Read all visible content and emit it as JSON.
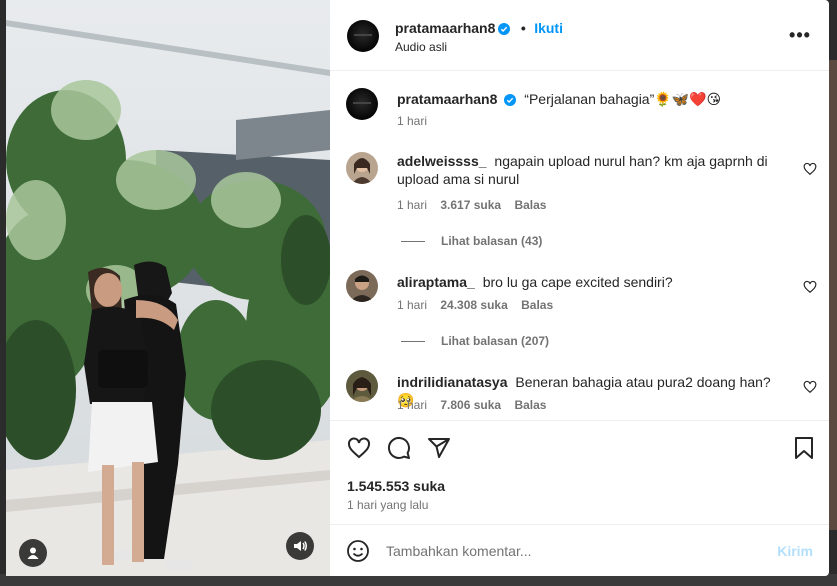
{
  "post": {
    "username": "pratamaarhan8",
    "follow_label": "Ikuti",
    "audio_label": "Audio asli",
    "more_label": "•••",
    "caption": "“Perjalanan bahagia”🌻🦋❤️😘",
    "caption_time": "1 hari",
    "likes_total": "1.545.553 suka",
    "time_ago": "1 hari yang lalu"
  },
  "comments": [
    {
      "username": "adelweissss_",
      "text": "ngapain upload nurul han? km aja gaprnh di upload ama si nurul",
      "time": "1 hari",
      "likes": "3.617 suka",
      "reply_label": "Balas",
      "view_replies": "Lihat balasan (43)"
    },
    {
      "username": "aliraptama_",
      "text": "bro lu ga cape excited sendiri?",
      "time": "1 hari",
      "likes": "24.308 suka",
      "reply_label": "Balas",
      "view_replies": "Lihat balasan (207)"
    },
    {
      "username": "indrilidianatasya",
      "text": "Beneran bahagia atau pura2 doang han?🥺",
      "time": "1 hari",
      "likes": "7.806 suka",
      "reply_label": "Balas"
    }
  ],
  "add_comment": {
    "placeholder": "Tambahkan komentar...",
    "post_label": "Kirim"
  },
  "colors": {
    "accent": "#0095f6",
    "verified": "#0095f6",
    "post_disabled": "#b2dffc",
    "heart_filled": "#ff3040"
  },
  "icons": {
    "like": "heart-icon",
    "comment": "comment-bubble-icon",
    "share": "paper-plane-icon",
    "save": "bookmark-icon",
    "emoji": "emoji-smiley-icon",
    "more": "more-options-icon",
    "audio": "speaker-icon",
    "tagged": "user-tag-icon"
  }
}
